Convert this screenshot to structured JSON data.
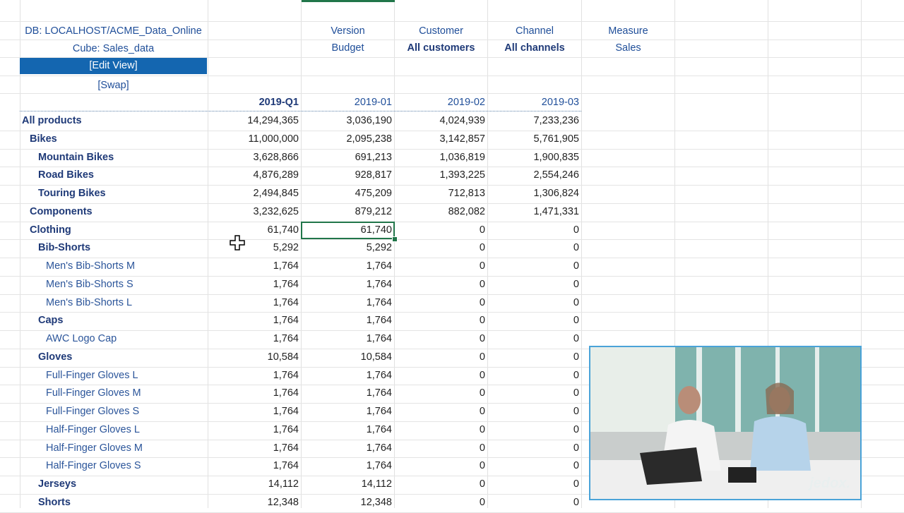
{
  "info": {
    "db": "DB: LOCALHOST/ACME_Data_Online",
    "cube": "Cube: Sales_data",
    "edit_view": "[Edit View]",
    "swap": "[Swap]"
  },
  "headers": [
    {
      "dim": "Version",
      "value": "Budget"
    },
    {
      "dim": "Customer",
      "value": "All customers"
    },
    {
      "dim": "Channel",
      "value": "All channels"
    },
    {
      "dim": "Measure",
      "value": "Sales"
    }
  ],
  "periods": [
    "2019-Q1",
    "2019-01",
    "2019-02",
    "2019-03"
  ],
  "rows": [
    {
      "label": "All products",
      "level": 0,
      "values": [
        "14,294,365",
        "3,036,190",
        "4,024,939",
        "7,233,236"
      ]
    },
    {
      "label": "Bikes",
      "level": 1,
      "values": [
        "11,000,000",
        "2,095,238",
        "3,142,857",
        "5,761,905"
      ]
    },
    {
      "label": "Mountain Bikes",
      "level": 2,
      "values": [
        "3,628,866",
        "691,213",
        "1,036,819",
        "1,900,835"
      ]
    },
    {
      "label": "Road Bikes",
      "level": 2,
      "values": [
        "4,876,289",
        "928,817",
        "1,393,225",
        "2,554,246"
      ]
    },
    {
      "label": "Touring Bikes",
      "level": 2,
      "values": [
        "2,494,845",
        "475,209",
        "712,813",
        "1,306,824"
      ]
    },
    {
      "label": "Components",
      "level": 1,
      "values": [
        "3,232,625",
        "879,212",
        "882,082",
        "1,471,331"
      ]
    },
    {
      "label": "Clothing",
      "level": 1,
      "values": [
        "61,740",
        "61,740",
        "0",
        "0"
      ]
    },
    {
      "label": "Bib-Shorts",
      "level": 2,
      "values": [
        "5,292",
        "5,292",
        "0",
        "0"
      ]
    },
    {
      "label": "Men's Bib-Shorts M",
      "level": 3,
      "values": [
        "1,764",
        "1,764",
        "0",
        "0"
      ]
    },
    {
      "label": "Men's Bib-Shorts S",
      "level": 3,
      "values": [
        "1,764",
        "1,764",
        "0",
        "0"
      ]
    },
    {
      "label": "Men's Bib-Shorts L",
      "level": 3,
      "values": [
        "1,764",
        "1,764",
        "0",
        "0"
      ]
    },
    {
      "label": "Caps",
      "level": 2,
      "values": [
        "1,764",
        "1,764",
        "0",
        "0"
      ]
    },
    {
      "label": "AWC Logo Cap",
      "level": 3,
      "values": [
        "1,764",
        "1,764",
        "0",
        "0"
      ]
    },
    {
      "label": "Gloves",
      "level": 2,
      "values": [
        "10,584",
        "10,584",
        "0",
        "0"
      ]
    },
    {
      "label": "Full-Finger Gloves L",
      "level": 3,
      "values": [
        "1,764",
        "1,764",
        "0",
        "0"
      ]
    },
    {
      "label": "Full-Finger Gloves M",
      "level": 3,
      "values": [
        "1,764",
        "1,764",
        "0",
        "0"
      ]
    },
    {
      "label": "Full-Finger Gloves S",
      "level": 3,
      "values": [
        "1,764",
        "1,764",
        "0",
        "0"
      ]
    },
    {
      "label": "Half-Finger Gloves L",
      "level": 3,
      "values": [
        "1,764",
        "1,764",
        "0",
        "0"
      ]
    },
    {
      "label": "Half-Finger Gloves M",
      "level": 3,
      "values": [
        "1,764",
        "1,764",
        "0",
        "0"
      ]
    },
    {
      "label": "Half-Finger Gloves S",
      "level": 3,
      "values": [
        "1,764",
        "1,764",
        "0",
        "0"
      ]
    },
    {
      "label": "Jerseys",
      "level": 2,
      "values": [
        "14,112",
        "14,112",
        "0",
        "0"
      ]
    },
    {
      "label": "Shorts",
      "level": 2,
      "values": [
        "12,348",
        "12,348",
        "0",
        "0"
      ]
    }
  ],
  "selected_cell": {
    "row": "Clothing",
    "period": "2019-01"
  },
  "video_overlay": {
    "watermark": "jedox."
  },
  "colors": {
    "accent": "#1466b0",
    "text_blue": "#1f4e99",
    "selection": "#21764a",
    "video_border": "#4aa3d8"
  }
}
